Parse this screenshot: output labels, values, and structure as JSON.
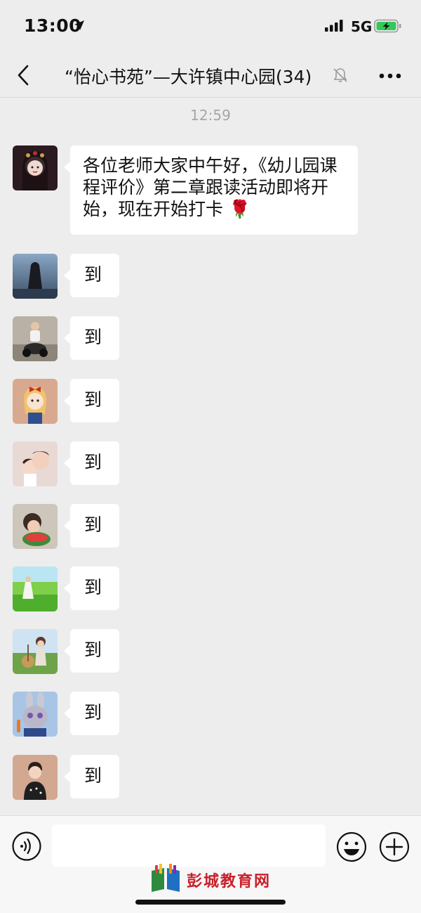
{
  "status_bar": {
    "time": "13:00",
    "network": "5G"
  },
  "header": {
    "title": "“怡心书苑”—大许镇中心园(34)"
  },
  "chat": {
    "timestamp": "12:59",
    "first_message": {
      "text": "各位老师大家中午好，《幼儿园课程评价》第二章跟读活动即将开始，现在开始打卡",
      "emoji": "🌹"
    },
    "replies": [
      "到",
      "到",
      "到",
      "到",
      "到",
      "到",
      "到",
      "到",
      "到"
    ]
  },
  "input": {
    "placeholder": ""
  },
  "watermark": {
    "text": "彭城教育网"
  },
  "colors": {
    "background": "#ededed",
    "bubble": "#ffffff",
    "battery_green": "#34c759"
  }
}
